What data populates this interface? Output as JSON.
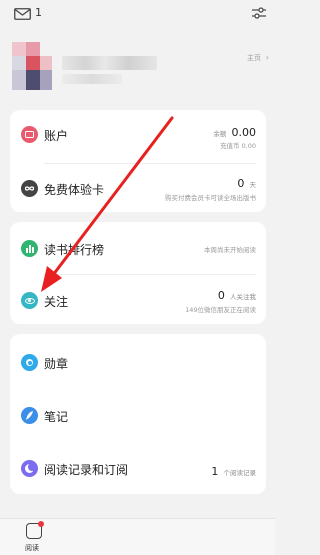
{
  "topbar": {
    "mail_icon": "mail-icon",
    "mail_count": "1",
    "filter_icon": "sliders-icon"
  },
  "profile": {
    "homepage_label": "主页",
    "chevron": "›"
  },
  "account": {
    "label": "账户",
    "balance_label": "余额",
    "balance_value": "0.00",
    "recharge_text": "充值币 0.00"
  },
  "trial": {
    "label": "免费体验卡",
    "days_value": "0",
    "days_unit": "天",
    "subtitle": "购买付费会员卡可读全场出版书"
  },
  "ranking": {
    "label": "读书排行榜",
    "subtitle": "本周尚未开始阅读"
  },
  "follow": {
    "label": "关注",
    "count": "0",
    "count_suffix": "人关注我",
    "subtitle": "149位微信朋友正在阅读"
  },
  "badges": {
    "label": "勋章"
  },
  "notes": {
    "label": "笔记"
  },
  "records": {
    "label": "阅读记录和订阅",
    "count": "1",
    "count_suffix": "个阅读记录"
  },
  "bottom_nav": {
    "read_label": "阅读"
  },
  "colors": {
    "account": "#e85a6d",
    "trial": "#444444",
    "ranking": "#2fb56f",
    "follow": "#35b6c4",
    "badges": "#2ea9ea",
    "notes": "#3a8fe8",
    "records": "#7b6cf0",
    "arrow": "#e82020"
  }
}
